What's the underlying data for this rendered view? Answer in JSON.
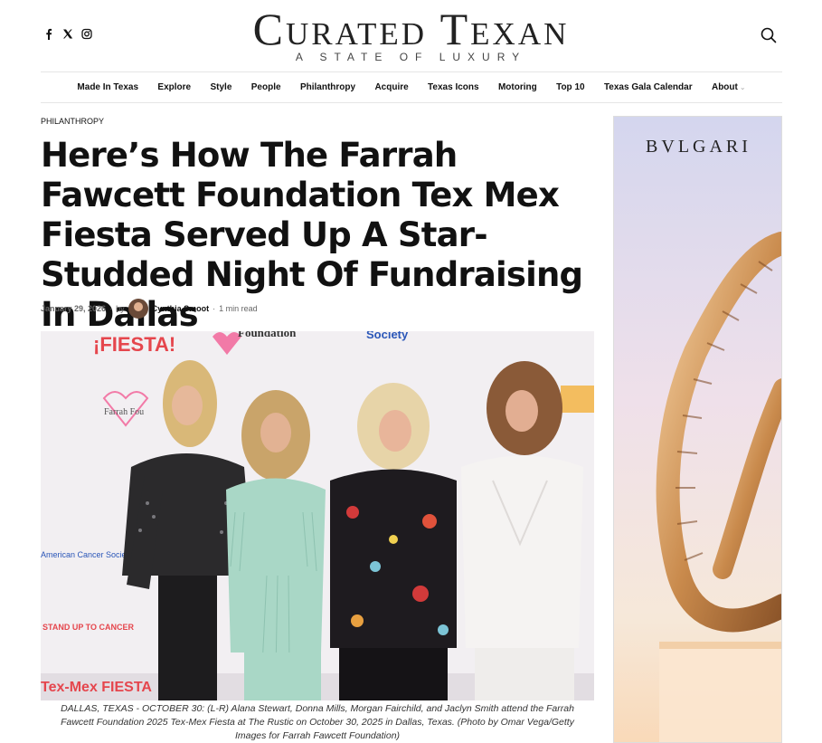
{
  "header": {
    "logo_main": "Curated Texan",
    "logo_tagline": "A STATE OF LUXURY",
    "social": [
      "facebook-icon",
      "x-icon",
      "instagram-icon"
    ],
    "search_icon": "search-icon"
  },
  "nav": {
    "items": [
      "Made In Texas",
      "Explore",
      "Style",
      "People",
      "Philanthropy",
      "Acquire",
      "Texas Icons",
      "Motoring",
      "Top 10",
      "Texas Gala Calendar",
      "About"
    ]
  },
  "article": {
    "category": "PHILANTHROPY",
    "title": "Here’s How The Farrah Fawcett Foundation Tex Mex Fiesta Served Up A Star-Studded Night Of Fundraising In Dallas",
    "date": "January 29, 2026",
    "by": "by",
    "author": "Cynthia Smoot",
    "read_time": "1 min read",
    "caption": "DALLAS, TEXAS - OCTOBER 30: (L-R) Alana Stewart, Donna Mills, Morgan Fairchild, and Jaclyn Smith attend the Farrah Fawcett Foundation 2025 Tex-Mex Fiesta at The Rustic on October 30, 2025 in Dallas, Texas. (Photo by Omar Vega/Getty Images for Farrah Fawcett Foundation)"
  },
  "photo_backdrop": {
    "fiesta_1": "¡FIESTA!",
    "foundation": "Foundation",
    "society": "Society",
    "farrah": "Farrah Fou",
    "acs": "American Cancer Society",
    "stand_up": "STAND UP TO CANCER",
    "tex_mex": "Tex-Mex FIESTA"
  },
  "ad": {
    "brand": "BVLGARI"
  }
}
